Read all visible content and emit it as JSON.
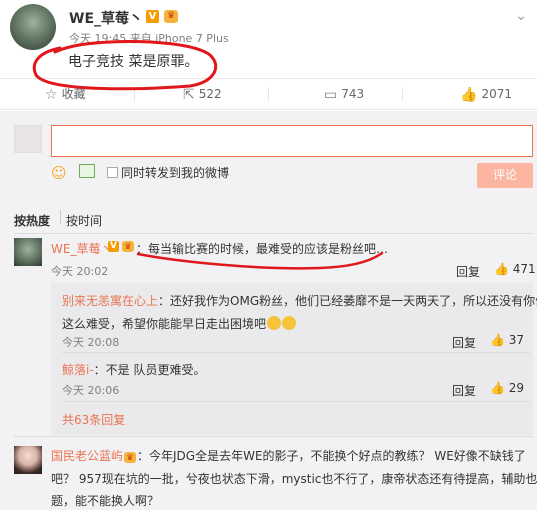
{
  "post": {
    "author": "WE_草莓丶",
    "vbadge": "V",
    "crown": "👑",
    "meta": "今天 19:45 来自 iPhone 7 Plus",
    "text": "电子竞技 菜是原罪。",
    "close_icon": "chevron-down-icon"
  },
  "actions": {
    "favorite_label": "收藏",
    "share_count": "522",
    "comment_count": "743",
    "like_count": "2071"
  },
  "composer": {
    "forward_label": "同时转发到我的微博",
    "submit_label": "评论"
  },
  "sort": {
    "hot_label": "按热度",
    "time_label": "按时间"
  },
  "comments": [
    {
      "author": "WE_草莓丶",
      "vbadge": "V",
      "crown": "👑",
      "text": "：每当输比赛的时候，最难受的应该是粉丝吧…",
      "time": "今天 20:02",
      "reply_label": "回复",
      "likes": "471",
      "replies": [
        {
          "author": "别来无恙寓在心上",
          "text_line1": "：还好我作为OMG粉丝，他们已经萎靡不是一天两天了，所以还没有你们",
          "text_line2": "这么难受，希望你能能早日走出困境吧",
          "time": "今天 20:08",
          "reply_label": "回复",
          "likes": "37"
        },
        {
          "author": "鲸落i-",
          "text": "：不是 队员更难受。",
          "time": "今天 20:06",
          "reply_label": "回复",
          "likes": "29"
        }
      ],
      "more_label": "共63条回复"
    },
    {
      "author": "国民老公蓝屿",
      "text_line1": "：今年JDG全是去年WE的影子，不能换个好点的教练？ WE好像不缺钱了",
      "text_line2": "吧？ 957现在坑的一批，兮夜也状态下滑，mystic也不行了，康帝状态还有待提高，辅助也有问",
      "text_line3": "题，能不能换人啊？"
    }
  ],
  "colors": {
    "accent": "#eb7350",
    "panel_bg": "#f2f2f5",
    "annotation": "#e0181b"
  }
}
